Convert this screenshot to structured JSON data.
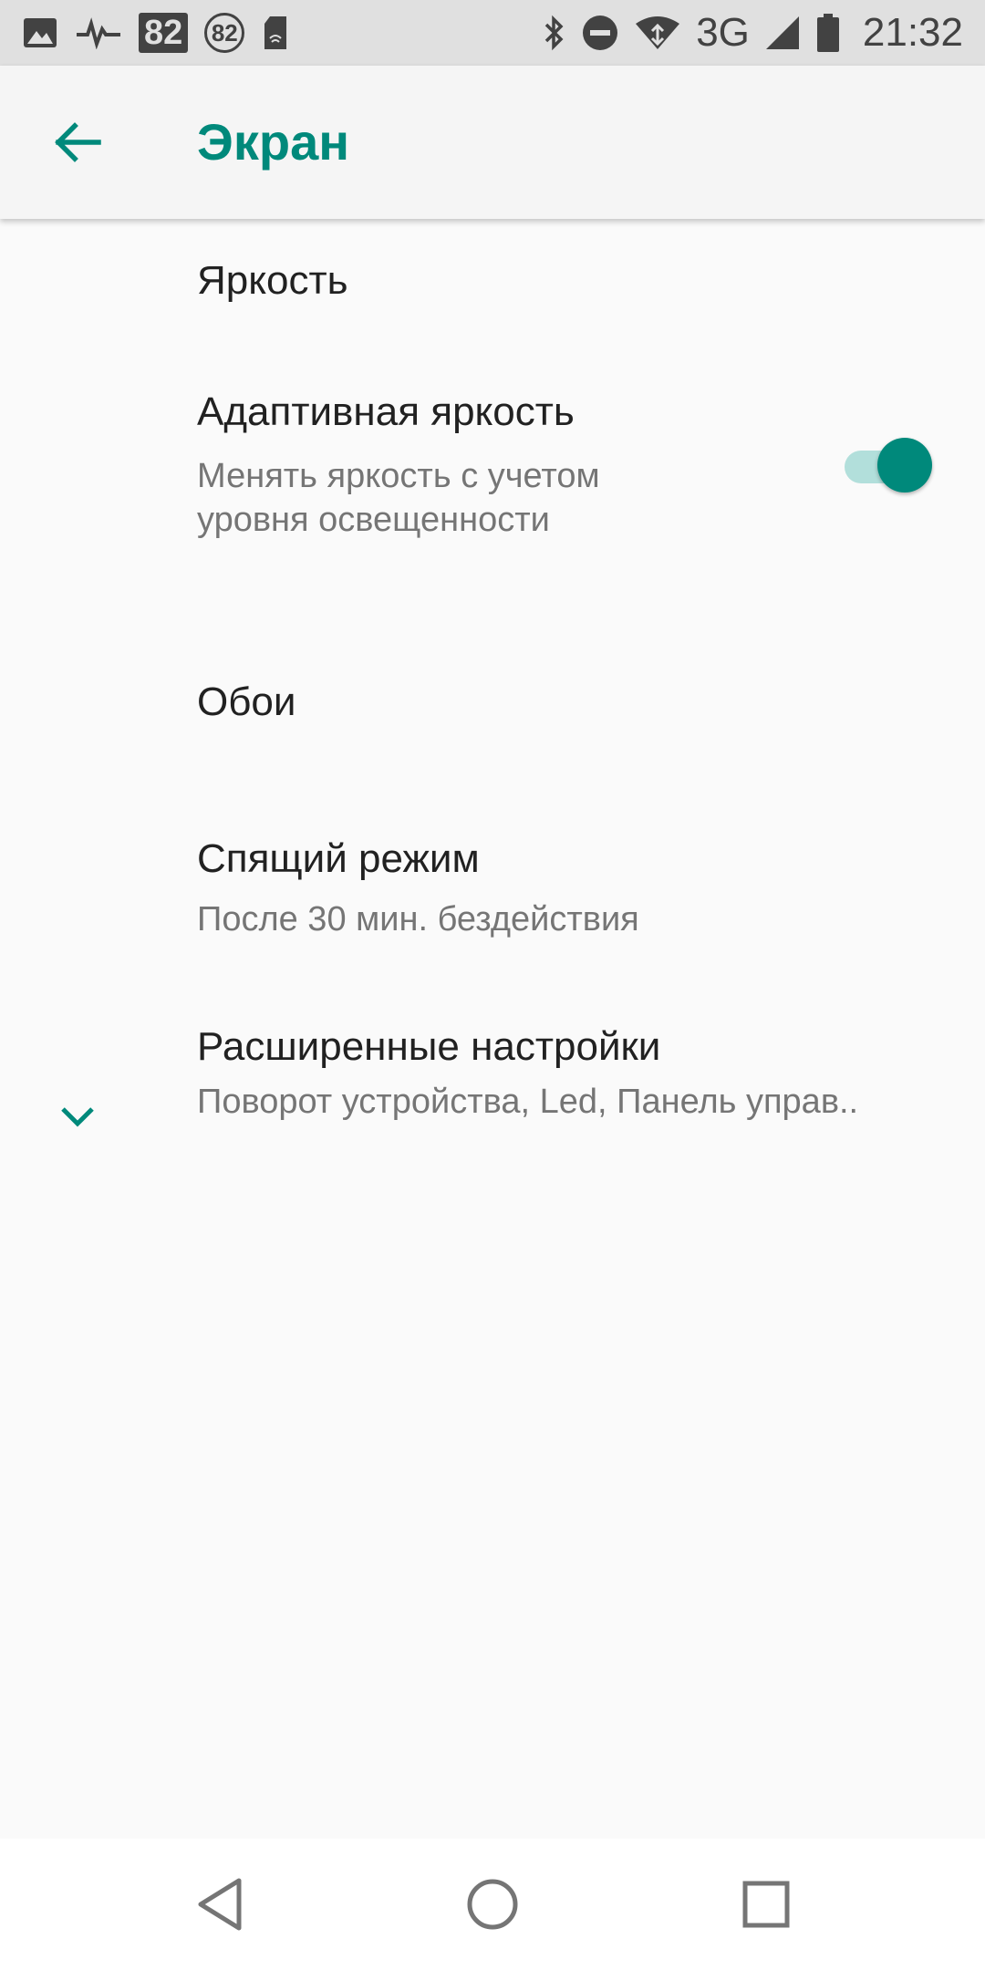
{
  "status_bar": {
    "badge_box": "82",
    "badge_circle": "82",
    "network": "3G",
    "time": "21:32",
    "icons": [
      "image-icon",
      "pulse-icon",
      "badge-82-icon",
      "badge-82-circle-icon",
      "sd-card-icon",
      "bluetooth-icon",
      "do-not-disturb-icon",
      "wifi-icon",
      "signal-icon",
      "battery-icon"
    ]
  },
  "app_bar": {
    "title": "Экран",
    "back_icon": "arrow-back-icon"
  },
  "items": [
    {
      "id": "brightness",
      "title": "Яркость"
    },
    {
      "id": "adaptive",
      "title": "Адаптивная яркость",
      "summary_line1": "Менять яркость с учетом",
      "summary_line2": "уровня освещенности",
      "toggle_on": true
    },
    {
      "id": "wallpaper",
      "title": "Обои"
    },
    {
      "id": "sleep",
      "title": "Спящий режим",
      "summary": "После 30 мин. бездействия"
    },
    {
      "id": "advanced",
      "title": "Расширенные настройки",
      "summary": "Поворот устройства, Led, Панель управ..",
      "icon": "chevron-down-icon"
    }
  ],
  "colors": {
    "accent": "#00897b",
    "accent_light": "#b2dfdb",
    "background": "#fafafa",
    "status_bar": "#e0e0e0"
  },
  "nav_bar": {
    "buttons": [
      "back-triangle-icon",
      "home-circle-icon",
      "recents-square-icon"
    ]
  }
}
